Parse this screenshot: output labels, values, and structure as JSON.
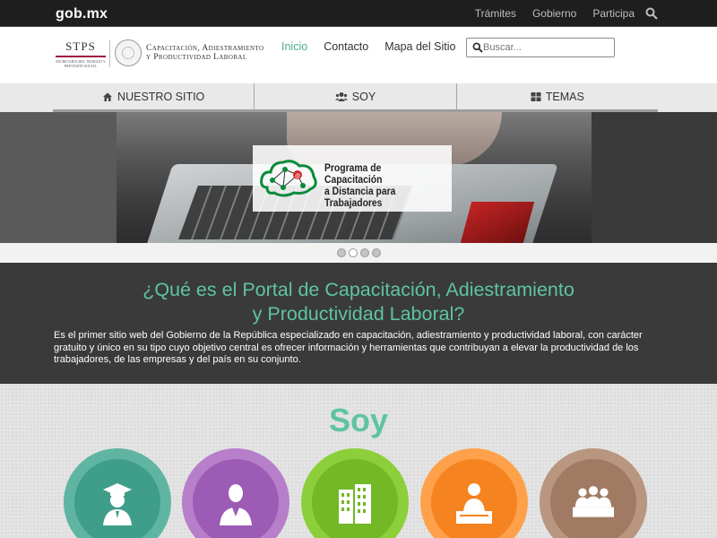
{
  "topbar": {
    "brand": "gob.mx",
    "links": [
      "Trámites",
      "Gobierno",
      "Participa"
    ]
  },
  "header": {
    "stps": "STPS",
    "stps_sub": "SECRETARÍA DEL TRABAJO Y PREVISIÓN SOCIAL",
    "title_line1": "Capacitación, Adiestramiento",
    "title_line2": "y Productividad Laboral",
    "nav": [
      "Inicio",
      "Contacto",
      "Mapa del Sitio"
    ],
    "search_placeholder": "Buscar..."
  },
  "tabs": [
    "NUESTRO SITIO",
    "SOY",
    "TEMAS"
  ],
  "hero": {
    "banner_line1": "Programa de Capacitación",
    "banner_line2": "a Distancia para Trabajadores",
    "slides": 4,
    "active_slide": 2
  },
  "info": {
    "title_line1": "¿Qué es el Portal de Capacitación, Adiestramiento",
    "title_line2": "y Productividad Laboral?",
    "body": "Es el primer sitio web del Gobierno de la República especializado en capacitación, adiestramiento y productividad laboral, con carácter gratuito y único en su tipo cuyo objetivo central es ofrecer información y herramientas que contribuyan a elevar la productividad de los trabajadores, de las empresas y del país en su conjunto."
  },
  "soy": {
    "title": "Soy",
    "circles": [
      {
        "icon": "graduate-icon",
        "outer": "#5fb5a2",
        "inner": "#3f9e8a"
      },
      {
        "icon": "worker-icon",
        "outer": "#b77fca",
        "inner": "#9c5bb4"
      },
      {
        "icon": "building-icon",
        "outer": "#8ccf3a",
        "inner": "#73b826"
      },
      {
        "icon": "speaker-icon",
        "outer": "#ffa14a",
        "inner": "#f5831f"
      },
      {
        "icon": "group-icon",
        "outer": "#b89680",
        "inner": "#a07a62"
      }
    ]
  },
  "colors": {
    "accent": "#5ec4a3",
    "topbar": "#1e1e1e",
    "info_bg": "#3a3a3a"
  }
}
